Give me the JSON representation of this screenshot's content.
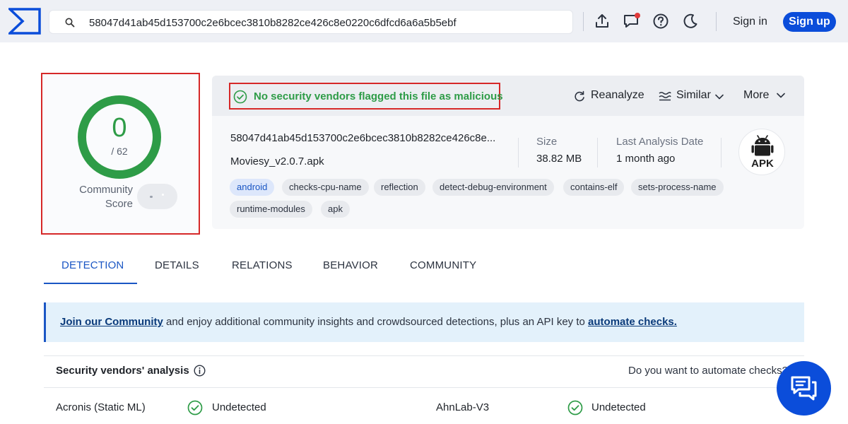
{
  "search": {
    "value": "58047d41ab45d153700c2e6bcec3810b8282ce426c8e0220c6dfcd6a6a5b5ebf"
  },
  "header": {
    "sign_in": "Sign in",
    "sign_up": "Sign up"
  },
  "score": {
    "detections": "0",
    "total": "/ 62",
    "community_label_line1": "Community",
    "community_label_line2": "Score"
  },
  "verdict": {
    "text": "No security vendors flagged this file as malicious",
    "color": "#2e9c47"
  },
  "actions": {
    "reanalyze": "Reanalyze",
    "similar": "Similar",
    "more": "More"
  },
  "file": {
    "hash_truncated": "58047d41ab45d153700c2e6bcec3810b8282ce426c8e...",
    "name": "Moviesy_v2.0.7.apk",
    "size_label": "Size",
    "size_value": "38.82 MB",
    "last_analysis_label": "Last Analysis Date",
    "last_analysis_value": "1 month ago",
    "type_badge": "APK"
  },
  "tags": [
    "android",
    "checks-cpu-name",
    "reflection",
    "detect-debug-environment",
    "contains-elf",
    "sets-process-name",
    "runtime-modules",
    "apk"
  ],
  "tabs": [
    "DETECTION",
    "DETAILS",
    "RELATIONS",
    "BEHAVIOR",
    "COMMUNITY"
  ],
  "banner": {
    "link1": "Join our Community",
    "middle": " and enjoy additional community insights and crowdsourced detections, plus an API key to ",
    "link2": "automate checks."
  },
  "vendors": {
    "title": "Security vendors' analysis",
    "automate_question": "Do you want to automate checks?",
    "rows": [
      {
        "name": "Acronis (Static ML)",
        "result": "Undetected"
      },
      {
        "name": "AhnLab-V3",
        "result": "Undetected"
      }
    ]
  },
  "colors": {
    "accent": "#0b4dda",
    "clean": "#2e9c47",
    "highlight_box": "#d62828"
  }
}
